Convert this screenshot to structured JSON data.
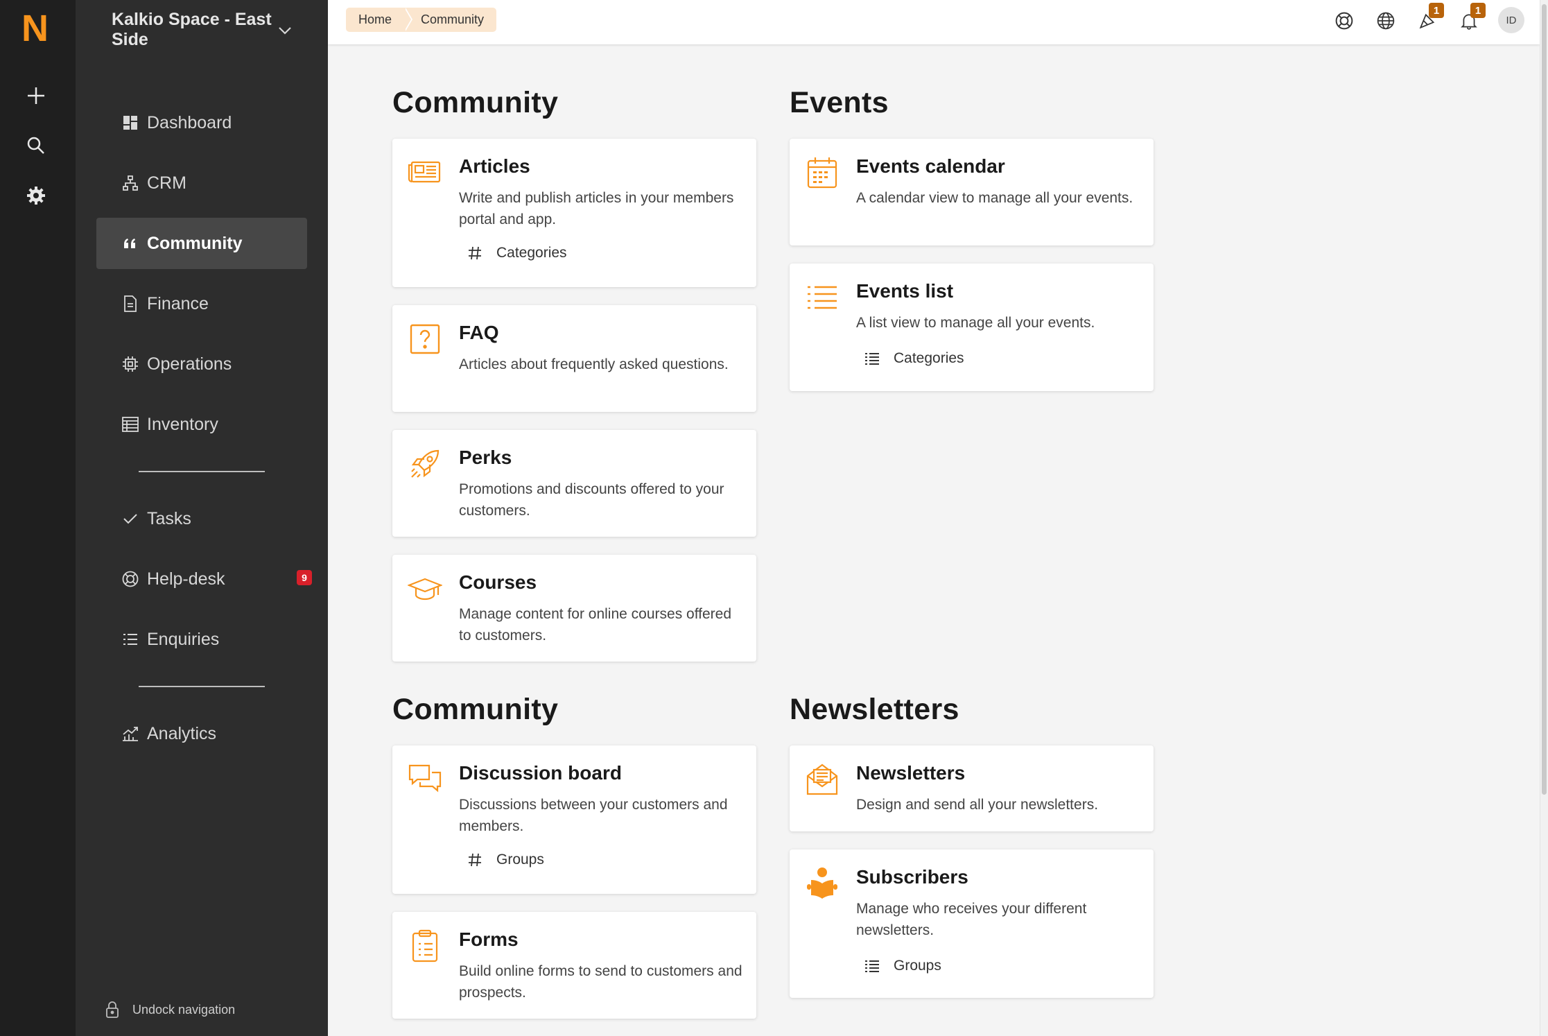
{
  "app": {
    "logo": "N",
    "brand_color": "#f7941d"
  },
  "workspace": {
    "name": "Kalkio Space - East Side"
  },
  "nav": [
    {
      "label": "Dashboard",
      "icon": "dashboard-icon"
    },
    {
      "label": "CRM",
      "icon": "org-chart-icon"
    },
    {
      "label": "Community",
      "icon": "quote-icon",
      "active": true
    },
    {
      "label": "Finance",
      "icon": "document-icon"
    },
    {
      "label": "Operations",
      "icon": "chip-icon"
    },
    {
      "label": "Inventory",
      "icon": "table-icon"
    },
    {
      "label": "Tasks",
      "icon": "check-icon"
    },
    {
      "label": "Help-desk",
      "icon": "lifebuoy-icon",
      "badge": "9"
    },
    {
      "label": "Enquiries",
      "icon": "list-icon"
    },
    {
      "label": "Analytics",
      "icon": "chart-icon"
    }
  ],
  "undock": {
    "label": "Undock navigation"
  },
  "breadcrumb": [
    "Home",
    "Community"
  ],
  "topbar": {
    "announce_badge": "1",
    "notif_badge": "1",
    "avatar": "ID"
  },
  "sections": {
    "community1": "Community",
    "events": "Events",
    "community2": "Community",
    "newsletters": "Newsletters"
  },
  "cards": {
    "articles": {
      "title": "Articles",
      "desc": "Write and publish articles in your members portal and app.",
      "sub": "Categories"
    },
    "faq": {
      "title": "FAQ",
      "desc": "Articles about frequently asked questions."
    },
    "perks": {
      "title": "Perks",
      "desc": "Promotions and discounts offered to your customers."
    },
    "courses": {
      "title": "Courses",
      "desc": "Manage content for online courses offered to customers."
    },
    "events_calendar": {
      "title": "Events calendar",
      "desc": "A calendar view to manage all your events."
    },
    "events_list": {
      "title": "Events list",
      "desc": "A list view to manage all your events.",
      "sub": "Categories"
    },
    "discussion": {
      "title": "Discussion board",
      "desc": "Discussions between your customers and members.",
      "sub": "Groups"
    },
    "forms": {
      "title": "Forms",
      "desc": "Build online forms to send to customers and prospects."
    },
    "newsletters": {
      "title": "Newsletters",
      "desc": "Design and send all your newsletters."
    },
    "subscribers": {
      "title": "Subscribers",
      "desc": "Manage who receives your different newsletters.",
      "sub": "Groups"
    }
  }
}
